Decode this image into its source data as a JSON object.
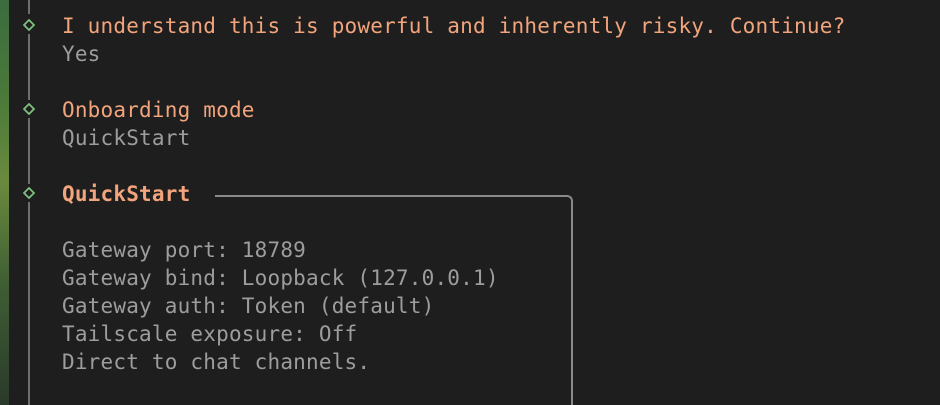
{
  "prompts": [
    {
      "question": "I understand this is powerful and inherently risky. Continue?",
      "answer": "Yes"
    },
    {
      "question": "Onboarding mode",
      "answer": "QuickStart"
    }
  ],
  "quickstart": {
    "title": "QuickStart",
    "lines": [
      "Gateway port: 18789",
      "Gateway bind: Loopback (127.0.0.1)",
      "Gateway auth: Token (default)",
      "Tailscale exposure: Off",
      "Direct to chat channels."
    ]
  },
  "colors": {
    "background": "#1e1e1e",
    "prompt_text": "#f2a47c",
    "answer_text": "#9d9d9d",
    "bullet": "#7fbf7f",
    "box_border": "#8a8a8a"
  },
  "icons": {
    "bullet": "diamond-bullet-icon"
  }
}
